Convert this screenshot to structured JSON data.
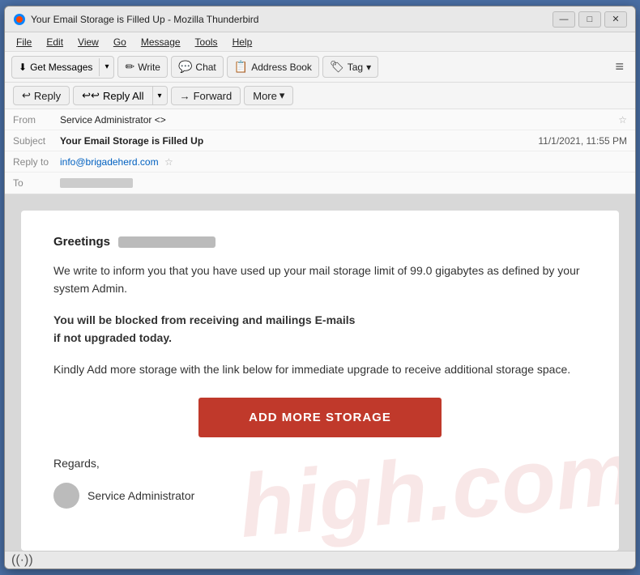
{
  "window": {
    "title": "Your Email Storage is Filled Up - Mozilla Thunderbird",
    "icon": "thunderbird"
  },
  "titlebar": {
    "minimize_label": "—",
    "maximize_label": "□",
    "close_label": "✕"
  },
  "menubar": {
    "items": [
      {
        "id": "file",
        "label": "File"
      },
      {
        "id": "edit",
        "label": "Edit"
      },
      {
        "id": "view",
        "label": "View"
      },
      {
        "id": "go",
        "label": "Go"
      },
      {
        "id": "message",
        "label": "Message"
      },
      {
        "id": "tools",
        "label": "Tools"
      },
      {
        "id": "help",
        "label": "Help"
      }
    ]
  },
  "toolbar": {
    "get_messages_label": "Get Messages",
    "write_label": "Write",
    "chat_label": "Chat",
    "address_book_label": "Address Book",
    "tag_label": "Tag",
    "overflow_icon": "≡"
  },
  "email_header": {
    "from_label": "From",
    "from_value": "Service Administrator <>",
    "subject_label": "Subject",
    "subject_value": "Your Email Storage is Filled Up",
    "date_value": "11/1/2021, 11:55 PM",
    "reply_to_label": "Reply to",
    "reply_to_value": "info@brigadeherd.com",
    "to_label": "To"
  },
  "actions": {
    "reply_label": "Reply",
    "reply_all_label": "Reply All",
    "forward_label": "Forward",
    "more_label": "More"
  },
  "email_body": {
    "greeting": "Greetings",
    "paragraph1": "We write to inform you that you have used up your mail storage limit of 99.0 gigabytes as defined by your system Admin.",
    "paragraph2_line1": "You will be blocked from receiving and mailings E-mails",
    "paragraph2_line2": "if not upgraded today.",
    "paragraph3": "Kindly Add more storage with the link below for immediate upgrade to receive additional storage space.",
    "cta_label": "ADD MORE STORAGE",
    "regards": "Regards,",
    "sender_name": "Service Administrator",
    "watermark_text": "high.com"
  },
  "statusbar": {
    "wifi_icon": "((·))"
  }
}
